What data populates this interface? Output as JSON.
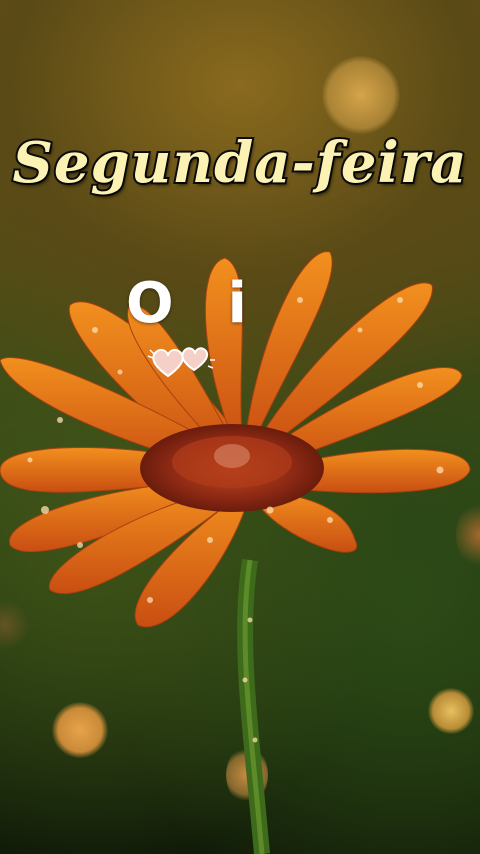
{
  "title": "Segunda-feira",
  "greeting": "Oi",
  "colors": {
    "title_fill": "#fbf2b4",
    "title_outline": "#111111",
    "flower_orange": "#e8701c",
    "flower_center": "#a0301a",
    "background_top": "#6b5016",
    "background_bottom": "#101a08"
  },
  "icons": [
    "hearts-doodle-icon"
  ]
}
